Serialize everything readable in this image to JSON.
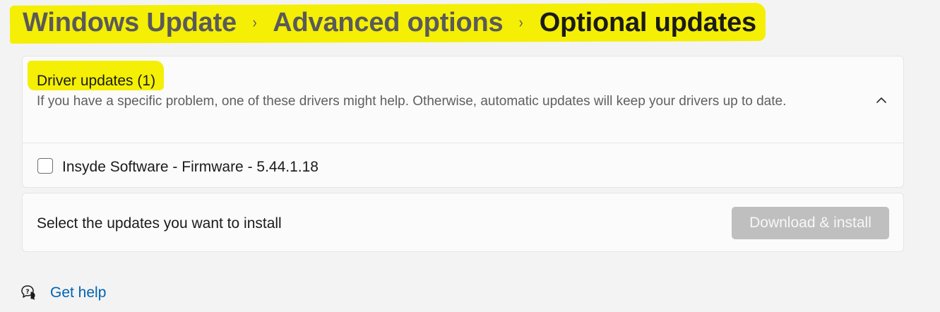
{
  "breadcrumb": {
    "items": [
      "Windows Update",
      "Advanced options",
      "Optional updates"
    ],
    "separator": "›"
  },
  "driver_section": {
    "title": "Driver updates (1)",
    "description": "If you have a specific problem, one of these drivers might help. Otherwise, automatic updates will keep your drivers up to date.",
    "expanded": true,
    "toggle_icon": "chevron-up-icon",
    "items": [
      {
        "label": "Insyde Software - Firmware - 5.44.1.18",
        "checked": false
      }
    ]
  },
  "install_section": {
    "text": "Select the updates you want to install",
    "button_label": "Download & install",
    "button_enabled": false
  },
  "help": {
    "icon": "get-help-icon",
    "label": "Get help"
  },
  "colors": {
    "highlight": "#f4ef05",
    "link": "#0063b1",
    "disabled_button": "#bfbfbf",
    "background": "#f3f3f3",
    "card": "#fbfbfb"
  }
}
